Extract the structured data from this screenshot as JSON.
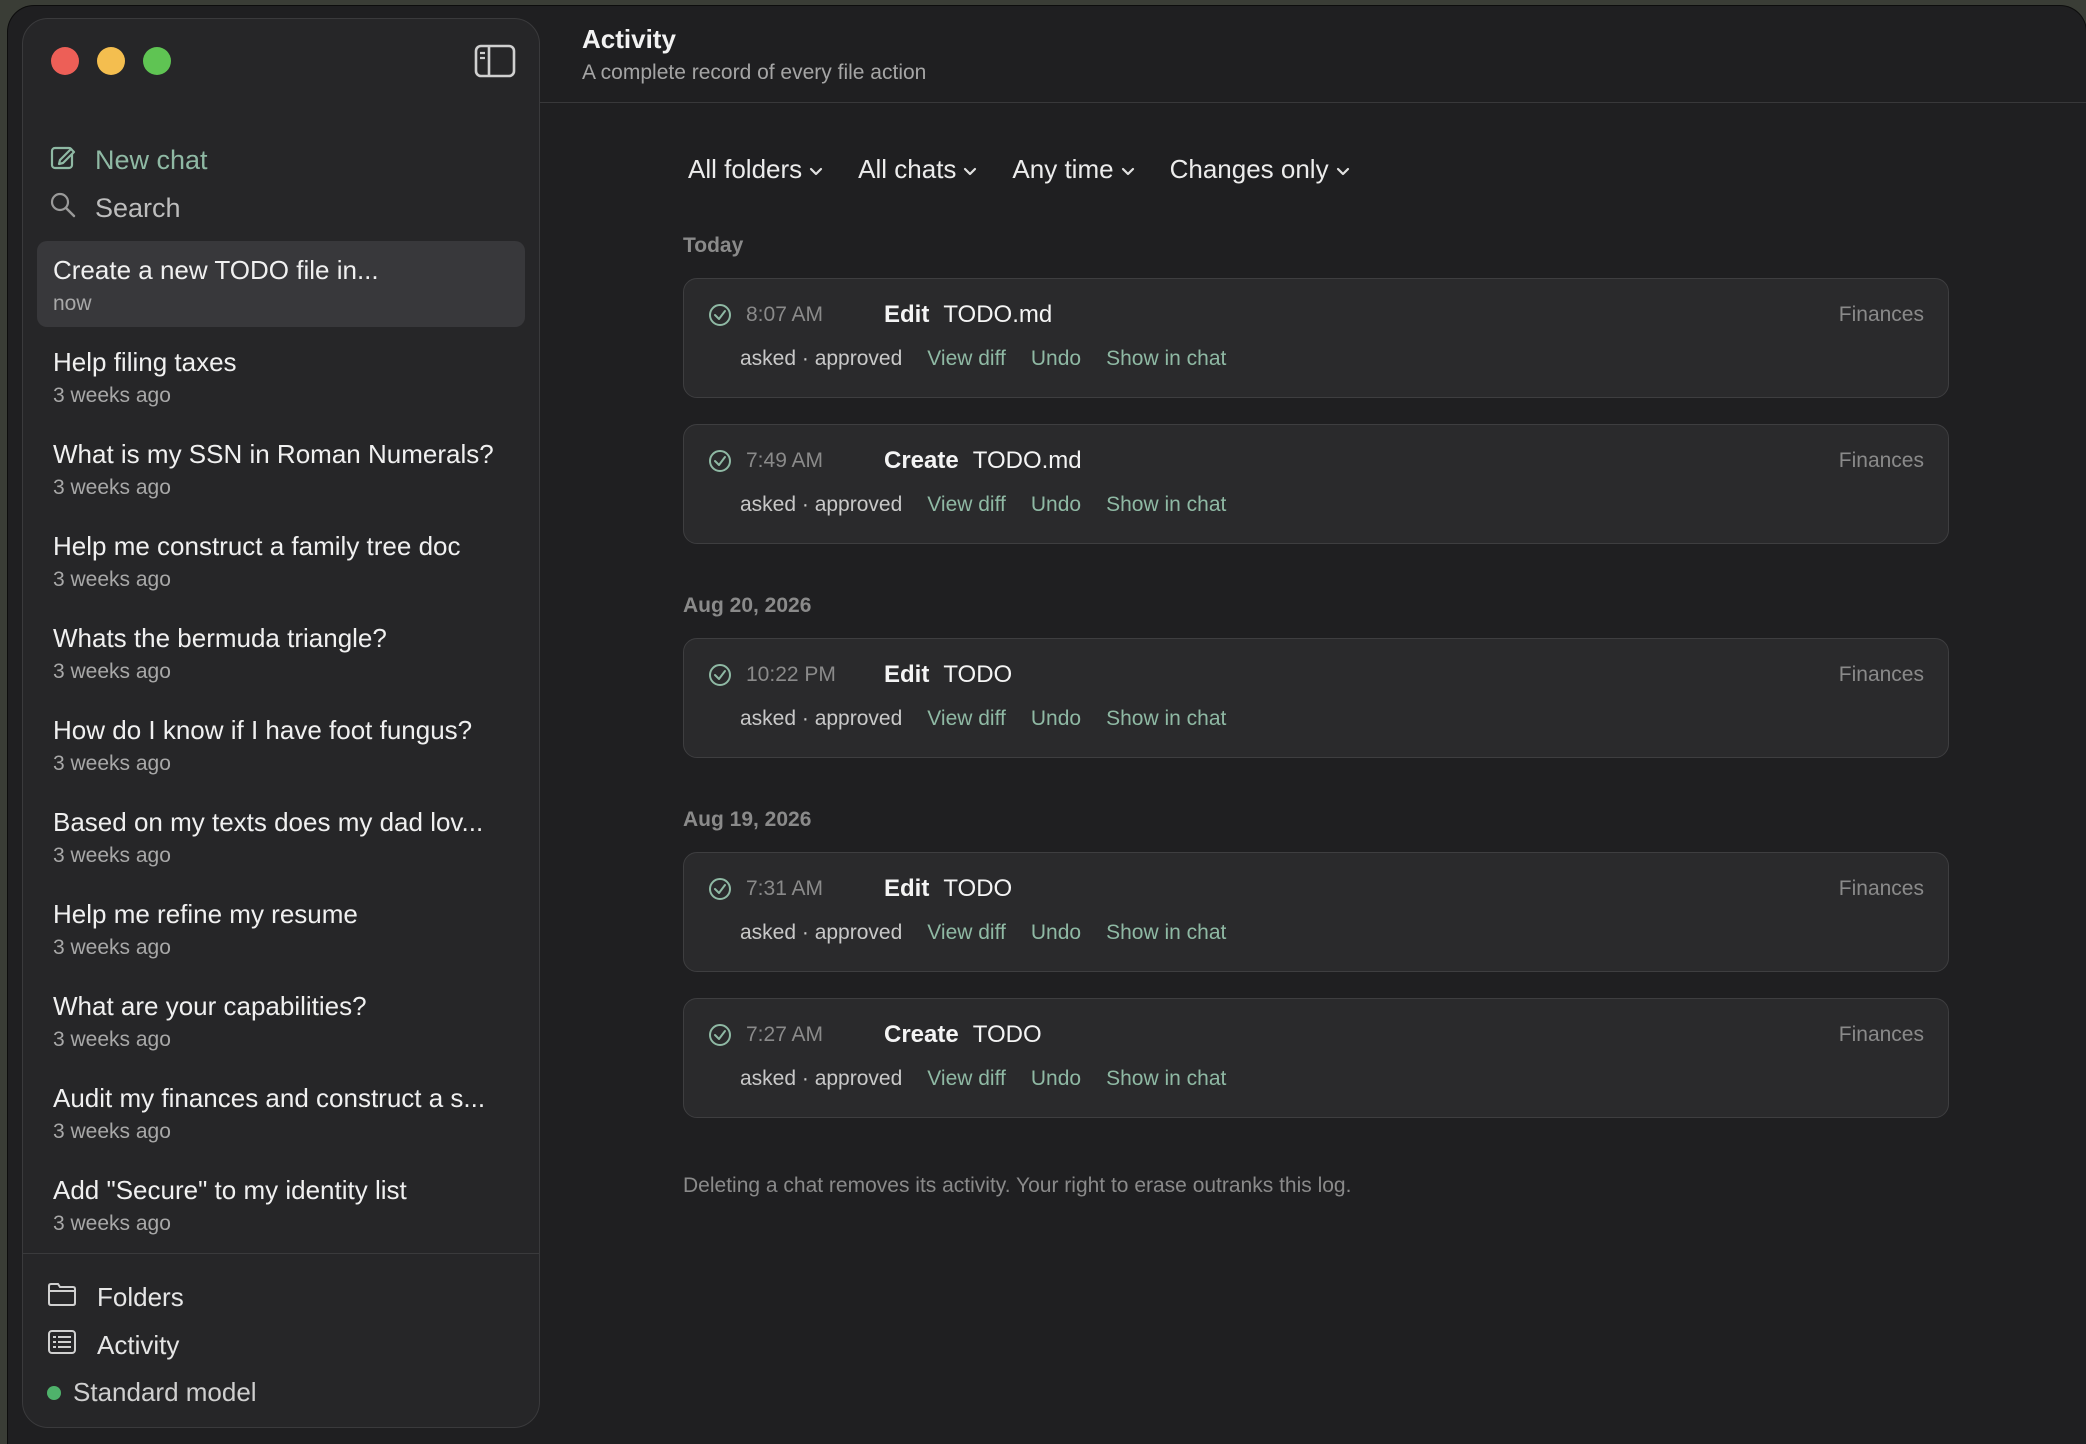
{
  "sidebar": {
    "new_chat": "New chat",
    "search": "Search",
    "chats": [
      {
        "title": "Create a new TODO file in...",
        "time": "now"
      },
      {
        "title": "Help filing taxes",
        "time": "3 weeks ago"
      },
      {
        "title": "What is my SSN in Roman Numerals?",
        "time": "3 weeks ago"
      },
      {
        "title": "Help me construct a family tree doc",
        "time": "3 weeks ago"
      },
      {
        "title": "Whats the bermuda triangle?",
        "time": "3 weeks ago"
      },
      {
        "title": "How do I know if I have foot fungus?",
        "time": "3 weeks ago"
      },
      {
        "title": "Based on my texts does my dad lov...",
        "time": "3 weeks ago"
      },
      {
        "title": "Help me refine my resume",
        "time": "3 weeks ago"
      },
      {
        "title": "What are your capabilities?",
        "time": "3 weeks ago"
      },
      {
        "title": "Audit my finances and construct a s...",
        "time": "3 weeks ago"
      },
      {
        "title": "Add \"Secure\" to my identity list",
        "time": "3 weeks ago"
      }
    ],
    "folders": "Folders",
    "activity": "Activity",
    "model": "Standard model"
  },
  "header": {
    "title": "Activity",
    "subtitle": "A complete record of every file action"
  },
  "filters": [
    "All folders",
    "All chats",
    "Any time",
    "Changes only"
  ],
  "sections": [
    {
      "label": "Today"
    },
    {
      "label": "Aug 20, 2026"
    },
    {
      "label": "Aug 19, 2026"
    }
  ],
  "entries": [
    {
      "time": "8:07 AM",
      "action": "Edit",
      "file": "TODO.md",
      "folder": "Finances",
      "status": "asked · approved"
    },
    {
      "time": "7:49 AM",
      "action": "Create",
      "file": "TODO.md",
      "folder": "Finances",
      "status": "asked · approved"
    },
    {
      "time": "10:22 PM",
      "action": "Edit",
      "file": "TODO",
      "folder": "Finances",
      "status": "asked · approved"
    },
    {
      "time": "7:31 AM",
      "action": "Edit",
      "file": "TODO",
      "folder": "Finances",
      "status": "asked · approved"
    },
    {
      "time": "7:27 AM",
      "action": "Create",
      "file": "TODO",
      "folder": "Finances",
      "status": "asked · approved"
    }
  ],
  "entry_links": {
    "view_diff": "View diff",
    "undo": "Undo",
    "show_in_chat": "Show in chat"
  },
  "footnote": "Deleting a chat removes its activity. Your right to erase outranks this log.",
  "colors": {
    "accent": "#8fb9a4",
    "status_dot": "#4fb26b",
    "close": "#ed5f57",
    "minimize": "#f4be4f",
    "maximize": "#5fc453"
  }
}
